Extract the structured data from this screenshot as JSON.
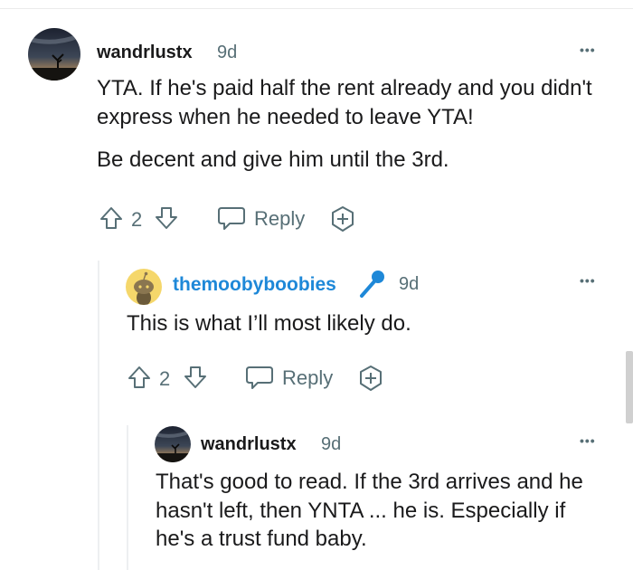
{
  "comments": [
    {
      "username": "wandrlustx",
      "age": "9d",
      "paragraphs": [
        "YTA. If he's paid half the rent already and you didn't express when he needed to leave YTA!",
        "Be decent and give him until the 3rd."
      ],
      "votes": "2",
      "reply_label": "Reply",
      "more_label": "•••",
      "avatar_icon": "night-sky-tree-avatar"
    },
    {
      "username": "themoobyboobies",
      "age": "9d",
      "flair_icon": "microphone-icon",
      "paragraphs": [
        "This is what I’ll most likely do."
      ],
      "votes": "2",
      "reply_label": "Reply",
      "more_label": "•••",
      "avatar_icon": "snoo-avatar"
    },
    {
      "username": "wandrlustx",
      "age": "9d",
      "paragraphs": [
        "That's good to read. If the 3rd arrives and he hasn't left, then YNTA ... he is. Especially if he's a trust fund baby."
      ],
      "more_label": "•••",
      "avatar_icon": "night-sky-tree-avatar"
    }
  ],
  "colors": {
    "username_link": "#1e88d8",
    "meta_gray": "#576f76",
    "text": "#1a1a1b"
  }
}
